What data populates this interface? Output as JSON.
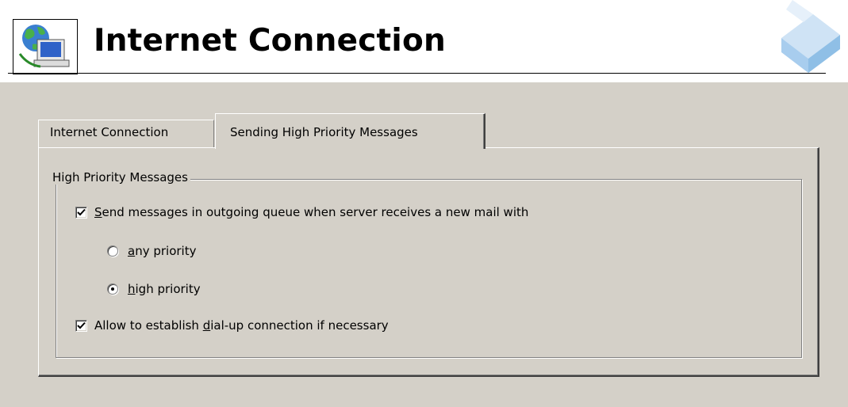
{
  "header": {
    "title": "Internet Connection",
    "app_icon": "internet-connection-globe-computer-icon",
    "brand_logo": "isometric-tile-logo"
  },
  "tabs": [
    {
      "label": "Internet Connection",
      "active": false
    },
    {
      "label": "Sending High Priority Messages",
      "active": true
    }
  ],
  "group": {
    "legend": "High Priority Messages",
    "send_checkbox": {
      "checked": true,
      "label_mnemonic": "S",
      "label_rest": "end messages in outgoing queue when server receives a new mail with"
    },
    "radio_any": {
      "selected": false,
      "label_mnemonic": "a",
      "label_rest": "ny priority"
    },
    "radio_high": {
      "selected": true,
      "label_mnemonic": "h",
      "label_rest": "igh priority"
    },
    "dialup_checkbox": {
      "checked": true,
      "label_before": "Allow to establish ",
      "label_mnemonic": "d",
      "label_rest": "ial-up connection if necessary"
    }
  },
  "colors": {
    "face": "#d4d0c8",
    "shadow": "#808080",
    "highlight": "#ffffff",
    "logo_blue": "#9cc8ea"
  }
}
